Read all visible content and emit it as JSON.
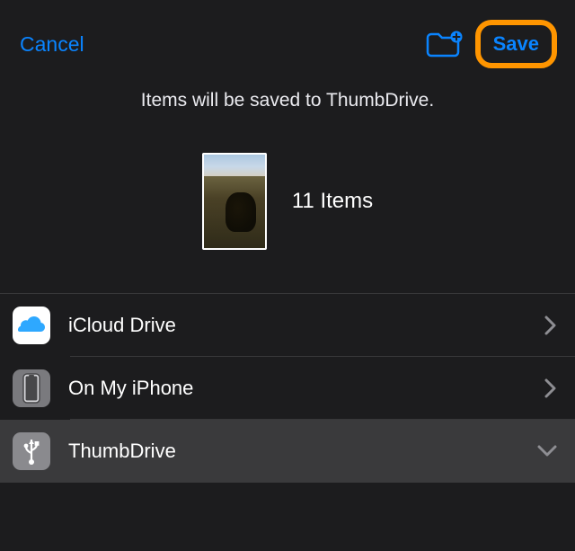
{
  "header": {
    "cancel_label": "Cancel",
    "save_label": "Save"
  },
  "subtitle": "Items will be saved to ThumbDrive.",
  "preview": {
    "item_count_label": "11 Items"
  },
  "locations": [
    {
      "label": "iCloud Drive",
      "icon": "icloud",
      "selected": false
    },
    {
      "label": "On My iPhone",
      "icon": "iphone",
      "selected": false
    },
    {
      "label": "ThumbDrive",
      "icon": "usb",
      "selected": true
    }
  ]
}
